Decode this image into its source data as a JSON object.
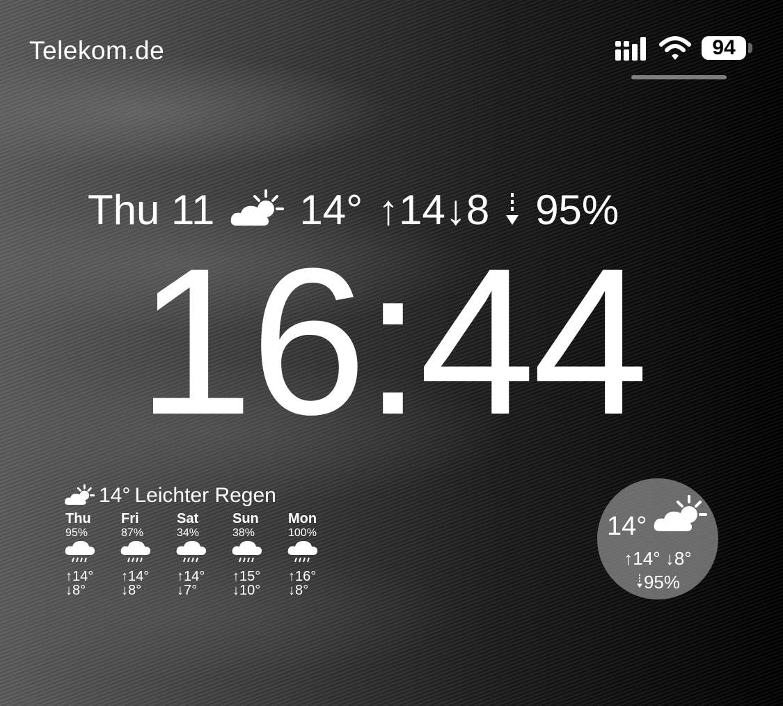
{
  "status_bar": {
    "carrier": "Telekom.de",
    "battery": "94"
  },
  "top_line": {
    "date": "Thu 11",
    "temp": "14°",
    "high_low": "↑14↓8",
    "precip": "95%"
  },
  "clock": {
    "time": "16:44"
  },
  "forecast_widget": {
    "current_temp": "14°",
    "condition": "Leichter Regen",
    "days": [
      {
        "name": "Thu",
        "prob": "95%",
        "hi": "↑14°",
        "lo": "↓8°"
      },
      {
        "name": "Fri",
        "prob": "87%",
        "hi": "↑14°",
        "lo": "↓8°"
      },
      {
        "name": "Sat",
        "prob": "34%",
        "hi": "↑14°",
        "lo": "↓7°"
      },
      {
        "name": "Sun",
        "prob": "38%",
        "hi": "↑15°",
        "lo": "↓10°"
      },
      {
        "name": "Mon",
        "prob": "100%",
        "hi": "↑16°",
        "lo": "↓8°"
      }
    ]
  },
  "circle_widget": {
    "temp": "14°",
    "high_low": "↑14° ↓8°",
    "precip": "95%"
  },
  "icons": {
    "weather": "partly-cloudy-icon",
    "rain": "rain-cloud-icon",
    "signal": "cellular-signal-icon",
    "wifi": "wifi-icon",
    "battery": "battery-icon"
  }
}
